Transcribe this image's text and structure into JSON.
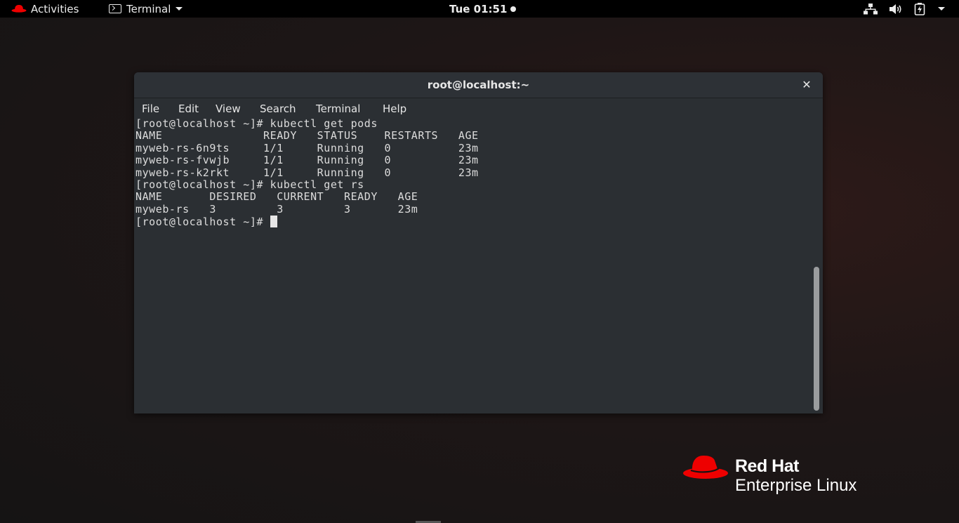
{
  "topbar": {
    "activities_label": "Activities",
    "app_menu_label": "Terminal",
    "clock": "Tue 01:51",
    "tray_icons": [
      "network-wired-icon",
      "volume-icon",
      "battery-icon",
      "system-menu-caret-icon"
    ]
  },
  "window": {
    "title": "root@localhost:~",
    "close_glyph": "✕",
    "menu": [
      "File",
      "Edit",
      "View",
      "Search",
      "Terminal",
      "Help"
    ]
  },
  "terminal": {
    "prompt": "[root@localhost ~]# ",
    "lines": [
      "[root@localhost ~]# kubectl get pods",
      "NAME               READY   STATUS    RESTARTS   AGE",
      "myweb-rs-6n9ts     1/1     Running   0          23m",
      "myweb-rs-fvwjb     1/1     Running   0          23m",
      "myweb-rs-k2rkt     1/1     Running   0          23m",
      "[root@localhost ~]# kubectl get rs",
      "NAME       DESIRED   CURRENT   READY   AGE",
      "myweb-rs   3         3         3       23m"
    ]
  },
  "branding": {
    "brand": "Red Hat",
    "product": "Enterprise Linux",
    "accent_color": "#ee0000"
  }
}
